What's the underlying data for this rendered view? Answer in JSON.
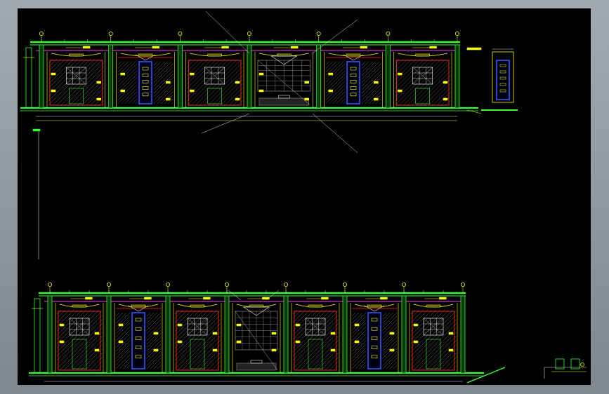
{
  "viewport": {
    "background": "#000000",
    "frame_color": "#8d949b"
  },
  "palette": {
    "green": "#33ff33",
    "yellow": "#ffff00",
    "red": "#ff2a2a",
    "magenta": "#ff33ff",
    "blue": "#3355ff",
    "white": "#dddddd",
    "cyan": "#33ffff",
    "gray": "#8a8a8a"
  },
  "drawing": {
    "views": [
      {
        "name": "upper-elevation",
        "bays": 6,
        "feature_bays": [
          1,
          4
        ],
        "lobby_bay": 3
      },
      {
        "name": "lower-elevation",
        "bays": 7,
        "feature_bays": [
          1,
          5
        ],
        "lobby_bay": 3
      }
    ],
    "detail_view": "side-panel-detail"
  }
}
